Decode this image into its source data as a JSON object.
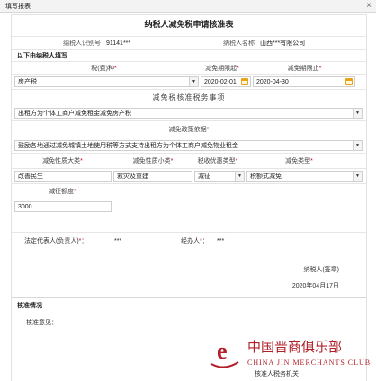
{
  "window": {
    "title": "填写报表",
    "close_icon": "×"
  },
  "form": {
    "title": "纳税人减免税申请核准表"
  },
  "taxpayer": {
    "id_label": "纳税人识别号",
    "id_value": "91141***",
    "name_label": "纳税人名称",
    "name_value": "山西***有限公司"
  },
  "section1": {
    "label": "以下由纳税人填写"
  },
  "tax_row": {
    "tax_label": "税(费)种",
    "start_label": "减免期限起",
    "end_label": "减免期限止",
    "tax_value": "房产税",
    "start_value": "2020-02-01",
    "end_value": "2020-04-30"
  },
  "matters": {
    "heading": "减免税核准税务事项",
    "value": "出租方为个体工商户减免租金减免房产税"
  },
  "policy": {
    "label": "减免政策依据",
    "value": "鼓励各地通过减免城镇土地使用税等方式支持出租方为个体工商户减免物业租金"
  },
  "nature": {
    "major_label": "减免性质大类",
    "minor_label": "减免性质小类",
    "pref_label": "税收优惠类型",
    "type_label": "减免类型",
    "major_value": "改善民生",
    "minor_value": "救灾及重建",
    "pref_value": "减征",
    "type_value": "税额式减免"
  },
  "amount": {
    "label": "减征额度",
    "value": "3000"
  },
  "sign": {
    "legal_label": "法定代表人(负责人)",
    "legal_value": "***",
    "agent_label": "经办人",
    "agent_value": "***",
    "seal_label": "纳税人(签章)",
    "date": "2020年04月17日"
  },
  "approval": {
    "heading": "核准情况",
    "opinion_label": "核准意见：",
    "office_label": "核准人税务机关"
  },
  "watermark": {
    "cn": "中国晋商俱乐部",
    "en": "CHINA JIN MERCHANTS CLUB",
    "color": "#b0202a"
  }
}
